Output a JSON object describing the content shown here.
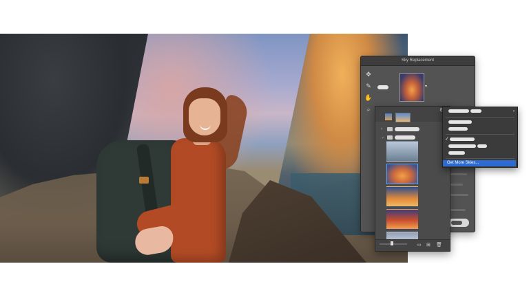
{
  "dialog": {
    "title": "Sky Replacement"
  },
  "menu": {
    "get_more_skies": "Get More Skies..."
  },
  "icons": {
    "move": "move-tool-icon",
    "brush": "sky-brush-icon",
    "hand": "hand-tool-icon",
    "zoom": "zoom-tool-icon",
    "gear": "gear-icon",
    "new_group": "new-group-icon",
    "new_sky": "new-sky-icon",
    "delete": "trash-icon"
  },
  "colors": {
    "menu_highlight": "#2d6bd1",
    "selection_border": "#59a4ff"
  }
}
